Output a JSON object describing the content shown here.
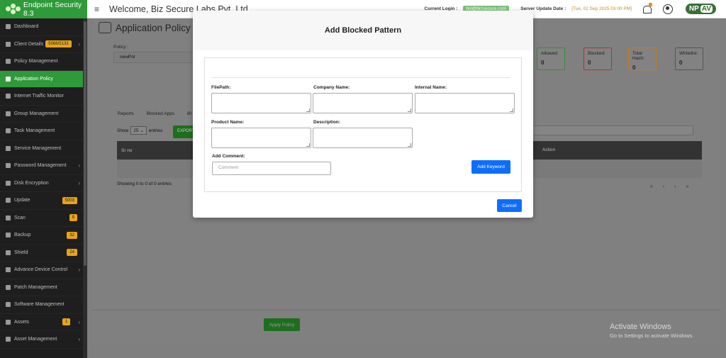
{
  "app": {
    "brand": "Endpoint Security 8.3",
    "welcome": "Welcome, Biz Secure Labs Pvt. Ltd.",
    "login_label": "Current Login :",
    "login_value": "bsl@bizsecure.com",
    "update_label": "Server Update Date :",
    "update_value": "[Tue, 02 Sep 2025 03:00 PM]",
    "logo_np": "NP",
    "logo_av": "AV"
  },
  "sidebar": {
    "items": [
      {
        "label": "Dashboard"
      },
      {
        "label": "Client Details",
        "badge": "5066/5133"
      },
      {
        "label": "Policy Management"
      },
      {
        "label": "Application Policy"
      },
      {
        "label": "Internet Traffic Monitor"
      },
      {
        "label": "Group Management"
      },
      {
        "label": "Task Management"
      },
      {
        "label": "Service Management"
      },
      {
        "label": "Password Management"
      },
      {
        "label": "Disk Encryption"
      },
      {
        "label": "Update",
        "badge": "5003"
      },
      {
        "label": "Scan",
        "badge": "8"
      },
      {
        "label": "Backup",
        "badge": "32"
      },
      {
        "label": "Shield",
        "badge": "24"
      },
      {
        "label": "Advance Device Control"
      },
      {
        "label": "Patch Management"
      },
      {
        "label": "Software Management"
      },
      {
        "label": "Assets",
        "badge": "1"
      },
      {
        "label": "Asset Management"
      }
    ]
  },
  "page": {
    "title": "Application Policy",
    "policy_label": "Policy :",
    "policy_value": "newPol",
    "stats": [
      {
        "label": "Allowed:",
        "value": "0",
        "color": "#3a8a3a"
      },
      {
        "label": "Blocked:",
        "value": "0",
        "color": "#b93030"
      },
      {
        "label": "Total Hash:",
        "value": "0",
        "color": "#c87a1a"
      },
      {
        "label": "Whitelist:",
        "value": "0",
        "color": "#555555"
      }
    ],
    "tabs": [
      "Reports",
      "Blocked Apps",
      "Bl"
    ],
    "show_label": "Show",
    "show_value": "25",
    "entries_label": "entries",
    "export_label": "EXPORT",
    "table_headers": [
      "Sr no",
      "Action"
    ],
    "showing": "Showing 0 to 0 of 0 entries",
    "pager": [
      "«",
      "‹",
      "›",
      "»"
    ],
    "apply_policy": "Apply Policy",
    "activate_title": "Activate Windows",
    "activate_sub": "Go to Settings to activate Windows."
  },
  "modal": {
    "title": "Add Blocked Pattern",
    "filepath_label": "FilePath:",
    "company_label": "Company Name:",
    "internal_label": "Internal Name:",
    "product_label": "Product Name:",
    "description_label": "Description:",
    "comment_label": "Add Comment:",
    "comment_placeholder": "Comment",
    "add_keyword": "Add Keyword",
    "cancel": "Cancel"
  },
  "colors": {
    "brand_green": "#2e9a3a",
    "primary_blue": "#0d6efd",
    "badge_amber": "#e8a317"
  }
}
